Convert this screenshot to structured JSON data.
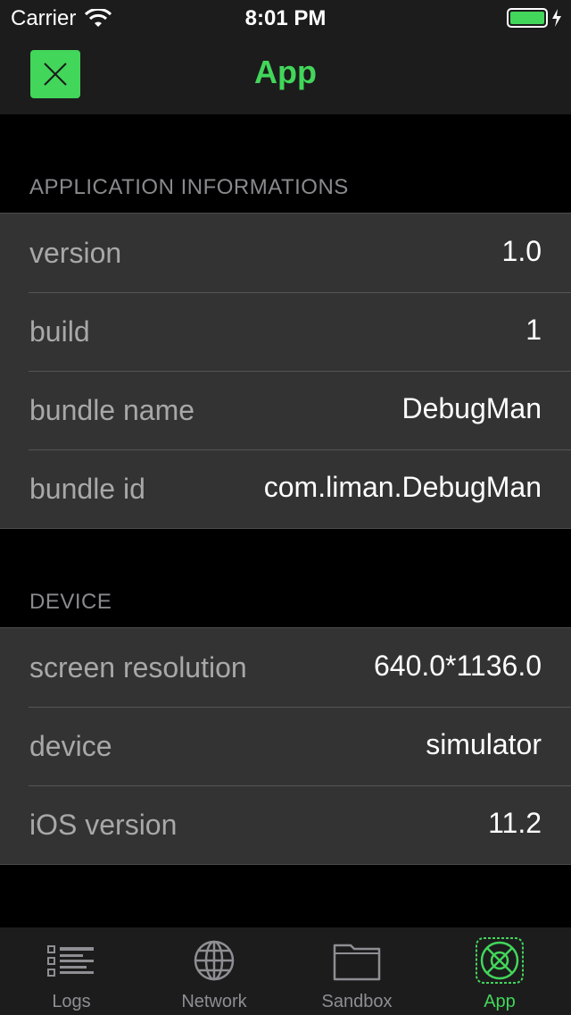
{
  "status_bar": {
    "carrier": "Carrier",
    "time": "8:01 PM"
  },
  "nav": {
    "title": "App"
  },
  "colors": {
    "accent": "#42d65a",
    "background": "#000000",
    "cell": "#333333",
    "bar": "#1c1c1d"
  },
  "sections": [
    {
      "header": "APPLICATION INFORMATIONS",
      "rows": [
        {
          "label": "version",
          "value": "1.0"
        },
        {
          "label": "build",
          "value": "1"
        },
        {
          "label": "bundle name",
          "value": "DebugMan"
        },
        {
          "label": "bundle id",
          "value": "com.liman.DebugMan"
        }
      ]
    },
    {
      "header": "DEVICE",
      "rows": [
        {
          "label": "screen resolution",
          "value": "640.0*1136.0"
        },
        {
          "label": "device",
          "value": "simulator"
        },
        {
          "label": "iOS version",
          "value": "11.2"
        }
      ]
    }
  ],
  "tabs": [
    {
      "label": "Logs",
      "icon": "list-icon",
      "active": false
    },
    {
      "label": "Network",
      "icon": "globe-icon",
      "active": false
    },
    {
      "label": "Sandbox",
      "icon": "folder-icon",
      "active": false
    },
    {
      "label": "App",
      "icon": "app-icon",
      "active": true
    }
  ]
}
